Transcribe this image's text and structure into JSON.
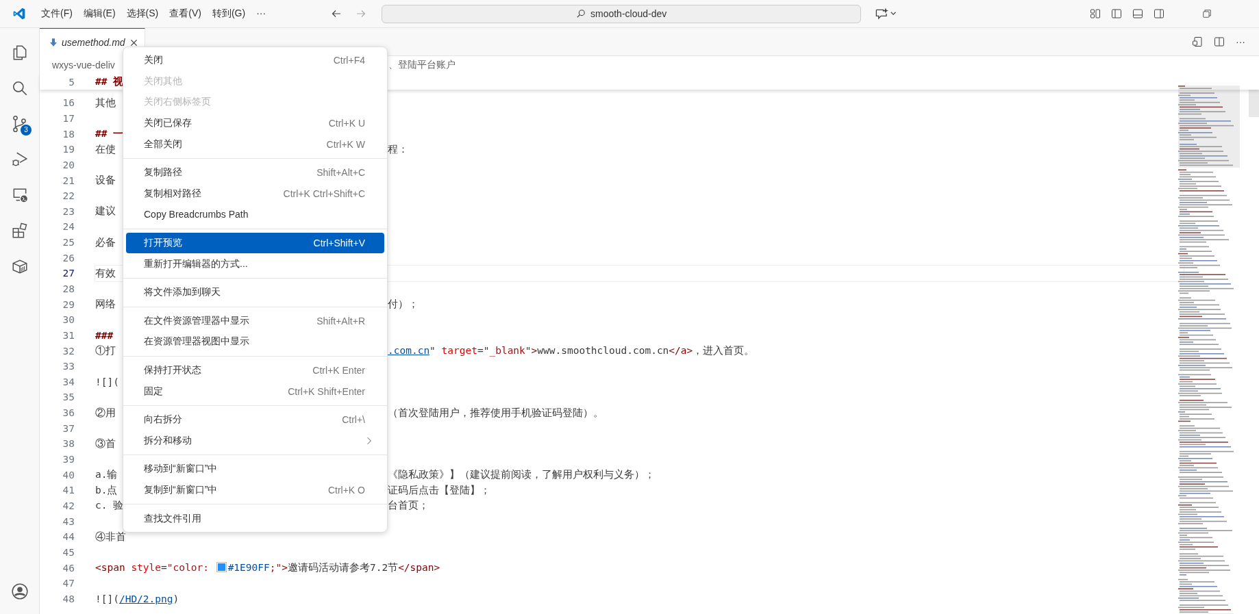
{
  "menubar": [
    "文件(F)",
    "编辑(E)",
    "选择(S)",
    "查看(V)",
    "转到(G)",
    "···"
  ],
  "search": {
    "value": "smooth-cloud-dev"
  },
  "source_control_badge": "3",
  "tab": {
    "title": "usemethod.md",
    "selected": true
  },
  "editor_actions": [
    "···"
  ],
  "breadcrumb": {
    "left": "wxys-vue-deliv",
    "right": "、登陆平台账户"
  },
  "sticky_line": {
    "number": "5",
    "left": [
      {
        "kind": "heading",
        "text": "## 视"
      }
    ]
  },
  "lines": [
    {
      "number": "16",
      "current": false,
      "left": [
        {
          "kind": "text",
          "text": "其他"
        }
      ]
    },
    {
      "number": "17",
      "current": false
    },
    {
      "number": "18",
      "current": false,
      "left": [
        {
          "kind": "heading",
          "text": "## 一"
        }
      ]
    },
    {
      "number": "19",
      "current": false,
      "left": [
        {
          "kind": "text",
          "text": "在使"
        }
      ],
      "right": [
        {
          "kind": "text",
          "text": "程："
        }
      ]
    },
    {
      "number": "20",
      "current": false
    },
    {
      "number": "21",
      "current": false,
      "left": [
        {
          "kind": "text",
          "text": "设备"
        }
      ]
    },
    {
      "number": "22",
      "current": false
    },
    {
      "number": "23",
      "current": false,
      "left": [
        {
          "kind": "text",
          "text": "建议"
        }
      ]
    },
    {
      "number": "24",
      "current": false
    },
    {
      "number": "25",
      "current": false,
      "left": [
        {
          "kind": "text",
          "text": "必备"
        }
      ]
    },
    {
      "number": "26",
      "current": false
    },
    {
      "number": "27",
      "current": true,
      "left": [
        {
          "kind": "text",
          "text": "有效"
        }
      ]
    },
    {
      "number": "28",
      "current": false
    },
    {
      "number": "29",
      "current": false,
      "left": [
        {
          "kind": "text",
          "text": "网络"
        }
      ],
      "right": [
        {
          "kind": "text",
          "text": "付）；"
        }
      ]
    },
    {
      "number": "30",
      "current": false
    },
    {
      "number": "31",
      "current": false,
      "left": [
        {
          "kind": "heading",
          "text": "###"
        }
      ]
    },
    {
      "number": "32",
      "current": false,
      "left": [
        {
          "kind": "text",
          "text": "①打"
        }
      ],
      "right": [
        {
          "kind": "link",
          "text": ".com.cn"
        },
        {
          "kind": "text",
          "text": "\" "
        },
        {
          "kind": "attr",
          "text": "target"
        },
        {
          "kind": "text",
          "text": "=\""
        },
        {
          "kind": "string",
          "text": "_blank"
        },
        {
          "kind": "text",
          "text": "\""
        },
        {
          "kind": "tag",
          "text": ">"
        },
        {
          "kind": "text",
          "text": "www.smoothcloud.com.cn"
        },
        {
          "kind": "tag",
          "text": "</a>"
        },
        {
          "kind": "text",
          "text": "，进入首页。"
        }
      ]
    },
    {
      "number": "33",
      "current": false
    },
    {
      "number": "34",
      "current": false,
      "left": [
        {
          "kind": "text",
          "text": "![]("
        }
      ]
    },
    {
      "number": "35",
      "current": false
    },
    {
      "number": "36",
      "current": false,
      "left": [
        {
          "kind": "text",
          "text": "②用"
        }
      ],
      "right": [
        {
          "kind": "text",
          "text": "（首次登陆用户，推荐使用手机验证码登陆）。"
        }
      ]
    },
    {
      "number": "37",
      "current": false
    },
    {
      "number": "38",
      "current": false,
      "left": [
        {
          "kind": "text",
          "text": "③首"
        }
      ]
    },
    {
      "number": "39",
      "current": false
    },
    {
      "number": "40",
      "current": false,
      "left": [
        {
          "kind": "text",
          "text": "a.输"
        }
      ],
      "right": [
        {
          "kind": "text",
          "text": "《隐私政策》】（建议提前阅读，了解用户权利与义务）；"
        }
      ]
    },
    {
      "number": "41",
      "current": false,
      "left": [
        {
          "kind": "text",
          "text": "b.点"
        }
      ],
      "right": [
        {
          "kind": "text",
          "text": "证码后点击【登陆】；"
        }
      ]
    },
    {
      "number": "42",
      "current": false,
      "left": [
        {
          "kind": "text",
          "text": "c. 验"
        }
      ],
      "right": [
        {
          "kind": "text",
          "text": "台首页；"
        }
      ]
    },
    {
      "number": "43",
      "current": false
    },
    {
      "number": "44",
      "current": false,
      "left": [
        {
          "kind": "text",
          "text": "④非首"
        }
      ]
    },
    {
      "number": "45",
      "current": false
    },
    {
      "number": "46",
      "current": false,
      "left": [
        {
          "kind": "tag",
          "text": "<span "
        },
        {
          "kind": "attr",
          "text": "style"
        },
        {
          "kind": "text",
          "text": "="
        },
        {
          "kind": "string",
          "text": "\"color: "
        },
        {
          "kind": "swatch",
          "color": "#1e90ff"
        },
        {
          "kind": "value",
          "text": "#1E90FF"
        },
        {
          "kind": "string",
          "text": ";\""
        },
        {
          "kind": "tag",
          "text": ">"
        },
        {
          "kind": "text",
          "text": "邀请码活动请参考7.2节"
        },
        {
          "kind": "tag",
          "text": "</span>"
        }
      ]
    },
    {
      "number": "47",
      "current": false
    },
    {
      "number": "48",
      "current": false,
      "left": [
        {
          "kind": "text",
          "text": "![]("
        },
        {
          "kind": "link",
          "text": "/HD/2.png"
        },
        {
          "kind": "text",
          "text": ")"
        }
      ]
    }
  ],
  "context_menu": [
    {
      "kind": "item",
      "label": "关闭",
      "shortcut": "Ctrl+F4",
      "disabled": false,
      "selected": false,
      "submenu": false
    },
    {
      "kind": "item",
      "label": "关闭其他",
      "disabled": true,
      "selected": false,
      "submenu": false
    },
    {
      "kind": "item",
      "label": "关闭右侧标签页",
      "disabled": true,
      "selected": false,
      "submenu": false
    },
    {
      "kind": "item",
      "label": "关闭已保存",
      "shortcut": "Ctrl+K U",
      "disabled": false,
      "selected": false,
      "submenu": false
    },
    {
      "kind": "item",
      "label": "全部关闭",
      "shortcut": "Ctrl+K W",
      "disabled": false,
      "selected": false,
      "submenu": false
    },
    {
      "kind": "separator"
    },
    {
      "kind": "item",
      "label": "复制路径",
      "shortcut": "Shift+Alt+C",
      "disabled": false,
      "selected": false,
      "submenu": false
    },
    {
      "kind": "item",
      "label": "复制相对路径",
      "shortcut": "Ctrl+K Ctrl+Shift+C",
      "disabled": false,
      "selected": false,
      "submenu": false
    },
    {
      "kind": "item",
      "label": "Copy Breadcrumbs Path",
      "disabled": false,
      "selected": false,
      "submenu": false
    },
    {
      "kind": "separator"
    },
    {
      "kind": "item",
      "label": "打开预览",
      "shortcut": "Ctrl+Shift+V",
      "disabled": false,
      "selected": true,
      "submenu": false
    },
    {
      "kind": "item",
      "label": "重新打开编辑器的方式...",
      "disabled": false,
      "selected": false,
      "submenu": false
    },
    {
      "kind": "separator"
    },
    {
      "kind": "item",
      "label": "将文件添加到聊天",
      "disabled": false,
      "selected": false,
      "submenu": false
    },
    {
      "kind": "separator"
    },
    {
      "kind": "item",
      "label": "在文件资源管理器中显示",
      "shortcut": "Shift+Alt+R",
      "disabled": false,
      "selected": false,
      "submenu": false
    },
    {
      "kind": "item",
      "label": "在资源管理器视图中显示",
      "disabled": false,
      "selected": false,
      "submenu": false
    },
    {
      "kind": "separator"
    },
    {
      "kind": "item",
      "label": "保持打开状态",
      "shortcut": "Ctrl+K Enter",
      "disabled": false,
      "selected": false,
      "submenu": false
    },
    {
      "kind": "item",
      "label": "固定",
      "shortcut": "Ctrl+K Shift+Enter",
      "disabled": false,
      "selected": false,
      "submenu": false
    },
    {
      "kind": "separator"
    },
    {
      "kind": "item",
      "label": "向右拆分",
      "shortcut": "Ctrl+\\",
      "disabled": false,
      "selected": false,
      "submenu": false
    },
    {
      "kind": "item",
      "label": "拆分和移动",
      "disabled": false,
      "selected": false,
      "submenu": true
    },
    {
      "kind": "separator"
    },
    {
      "kind": "item",
      "label": "移动到“新窗口”中",
      "disabled": false,
      "selected": false,
      "submenu": false
    },
    {
      "kind": "item",
      "label": "复制到“新窗口”中",
      "shortcut": "Ctrl+K O",
      "disabled": false,
      "selected": false,
      "submenu": false
    },
    {
      "kind": "separator"
    },
    {
      "kind": "item",
      "label": "查找文件引用",
      "disabled": false,
      "selected": false,
      "submenu": false
    }
  ]
}
